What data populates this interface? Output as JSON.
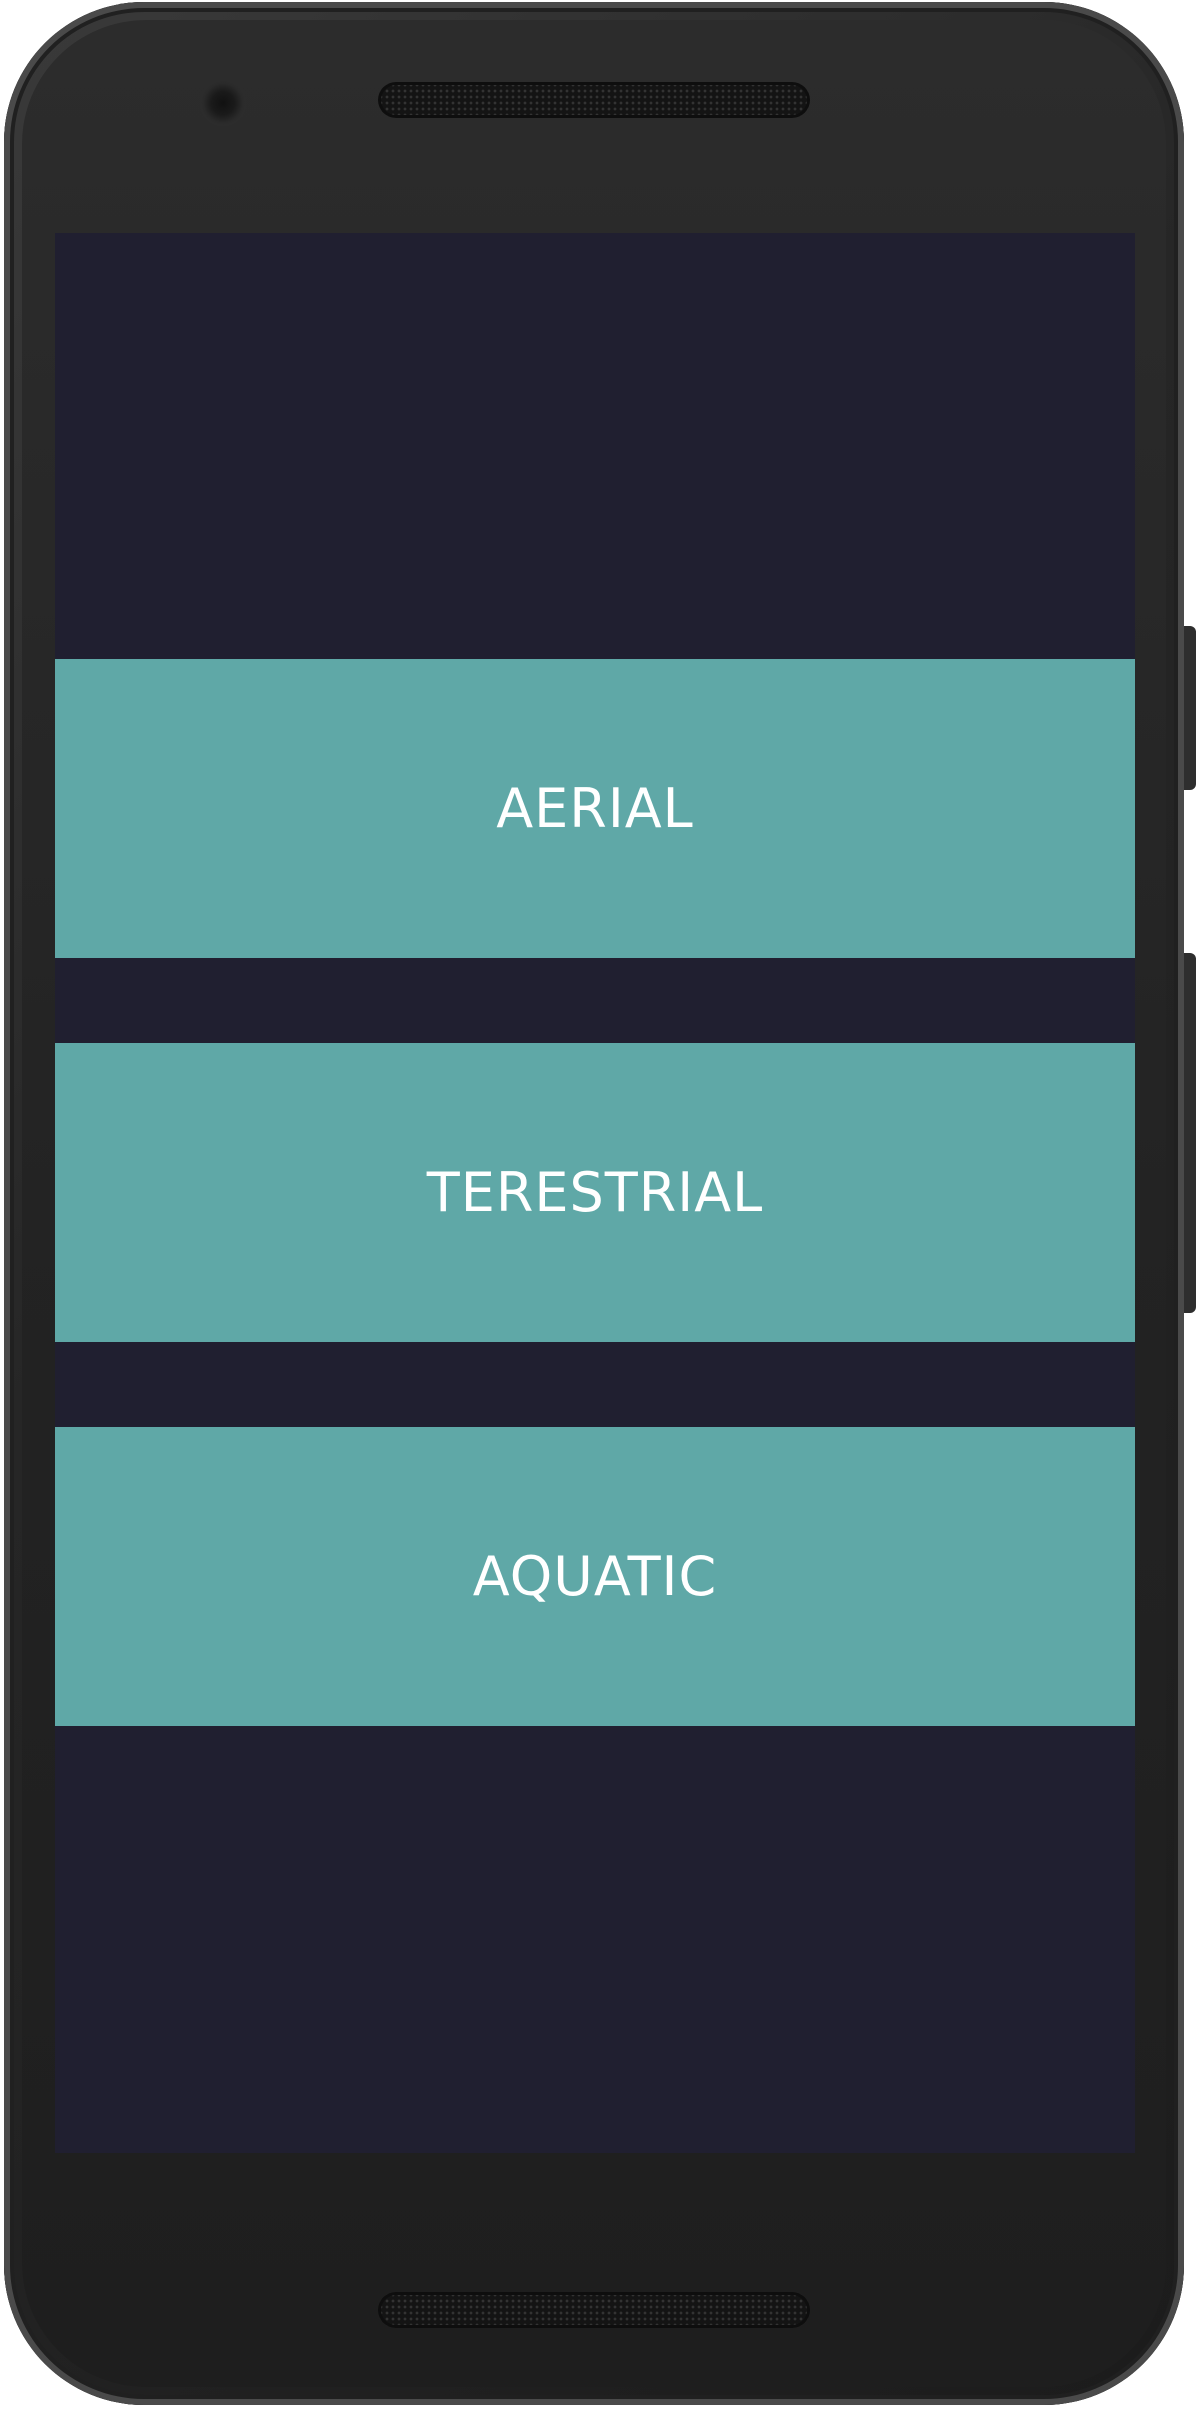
{
  "device": {
    "frame_color": "#262626",
    "screen_background": "#201f30"
  },
  "categories": {
    "accent_color": "#5fa8a7",
    "text_color": "#ffffff",
    "items": [
      {
        "label": "AERIAL"
      },
      {
        "label": "TERESTRIAL"
      },
      {
        "label": "AQUATIC"
      }
    ]
  }
}
